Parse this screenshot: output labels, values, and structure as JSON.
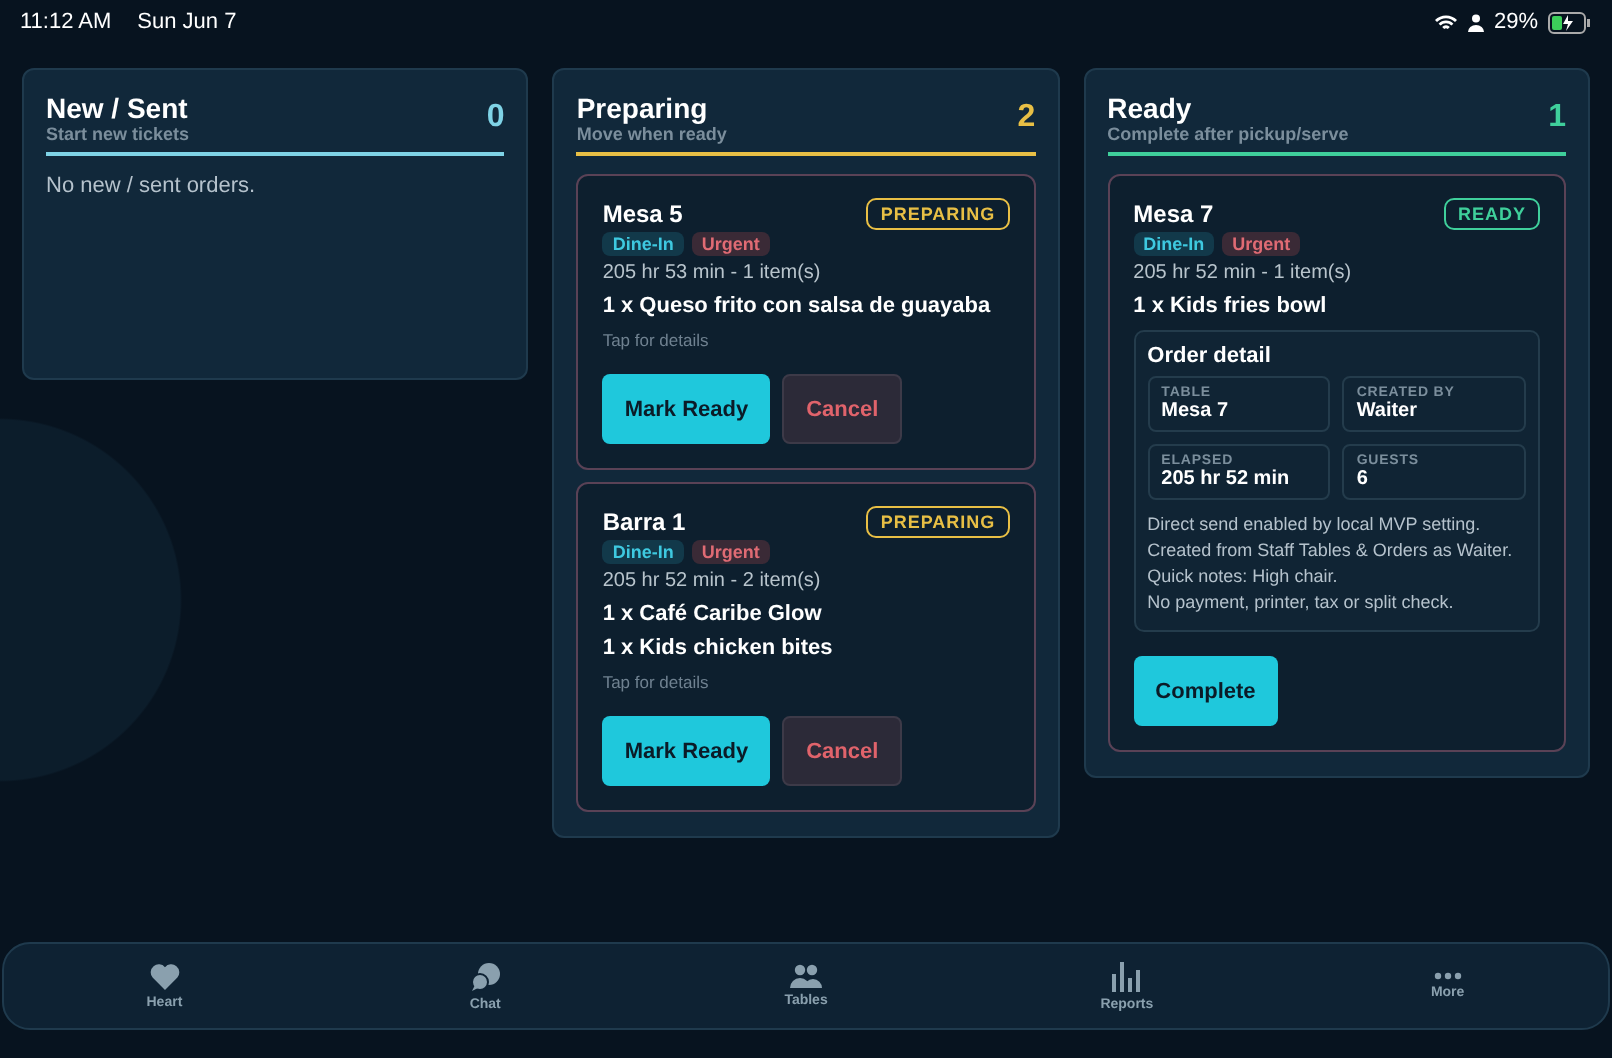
{
  "status_bar": {
    "time": "11:12 AM",
    "date": "Sun Jun 7",
    "battery": "29%"
  },
  "columns": [
    {
      "title": "New / Sent",
      "subtitle": "Start new tickets",
      "count": "0",
      "color": "#7fd3e6",
      "empty_text": "No new / sent orders."
    },
    {
      "title": "Preparing",
      "subtitle": "Move when ready",
      "count": "2",
      "color": "#e8bf45",
      "tickets": [
        {
          "name": "Mesa 5",
          "status": "PREPARING",
          "tags": [
            {
              "label": "Dine-In",
              "kind": "service"
            },
            {
              "label": "Urgent",
              "kind": "priority"
            }
          ],
          "meta": "205 hr 53 min - 1 item(s)",
          "items": [
            "1 x Queso frito con salsa de guayaba"
          ],
          "hint": "Tap for details",
          "buttons": [
            {
              "label": "Mark Ready",
              "kind": "primary"
            },
            {
              "label": "Cancel",
              "kind": "danger"
            }
          ]
        },
        {
          "name": "Barra 1",
          "status": "PREPARING",
          "tags": [
            {
              "label": "Dine-In",
              "kind": "service"
            },
            {
              "label": "Urgent",
              "kind": "priority"
            }
          ],
          "meta": "205 hr 52 min - 2 item(s)",
          "items": [
            "1 x Café Caribe Glow",
            "1 x Kids chicken bites"
          ],
          "hint": "Tap for details",
          "buttons": [
            {
              "label": "Mark Ready",
              "kind": "primary"
            },
            {
              "label": "Cancel",
              "kind": "danger"
            }
          ]
        }
      ]
    },
    {
      "title": "Ready",
      "subtitle": "Complete after pickup/serve",
      "count": "1",
      "color": "#3fcf9b",
      "tickets": [
        {
          "name": "Mesa 7",
          "status": "READY",
          "tags": [
            {
              "label": "Dine-In",
              "kind": "service"
            },
            {
              "label": "Urgent",
              "kind": "priority"
            }
          ],
          "meta": "205 hr 52 min - 1 item(s)",
          "items": [
            "1 x Kids fries bowl"
          ],
          "detail": {
            "title": "Order detail",
            "fields": [
              {
                "label": "TABLE",
                "value": "Mesa 7"
              },
              {
                "label": "CREATED BY",
                "value": "Waiter"
              },
              {
                "label": "ELAPSED",
                "value": "205 hr 52 min"
              },
              {
                "label": "GUESTS",
                "value": "6"
              }
            ],
            "notes": [
              "Direct send enabled by local MVP setting.",
              "Created from Staff Tables & Orders as Waiter.",
              "Quick notes: High chair.",
              "No payment, printer, tax or split check."
            ]
          },
          "buttons": [
            {
              "label": "Complete",
              "kind": "primary"
            }
          ]
        }
      ]
    }
  ],
  "tab_bar": [
    {
      "label": "Heart",
      "kind": "heart"
    },
    {
      "label": "Chat",
      "kind": "chat"
    },
    {
      "label": "Tables",
      "kind": "people"
    },
    {
      "label": "Reports",
      "kind": "bars"
    },
    {
      "label": "More",
      "kind": "dots"
    }
  ]
}
